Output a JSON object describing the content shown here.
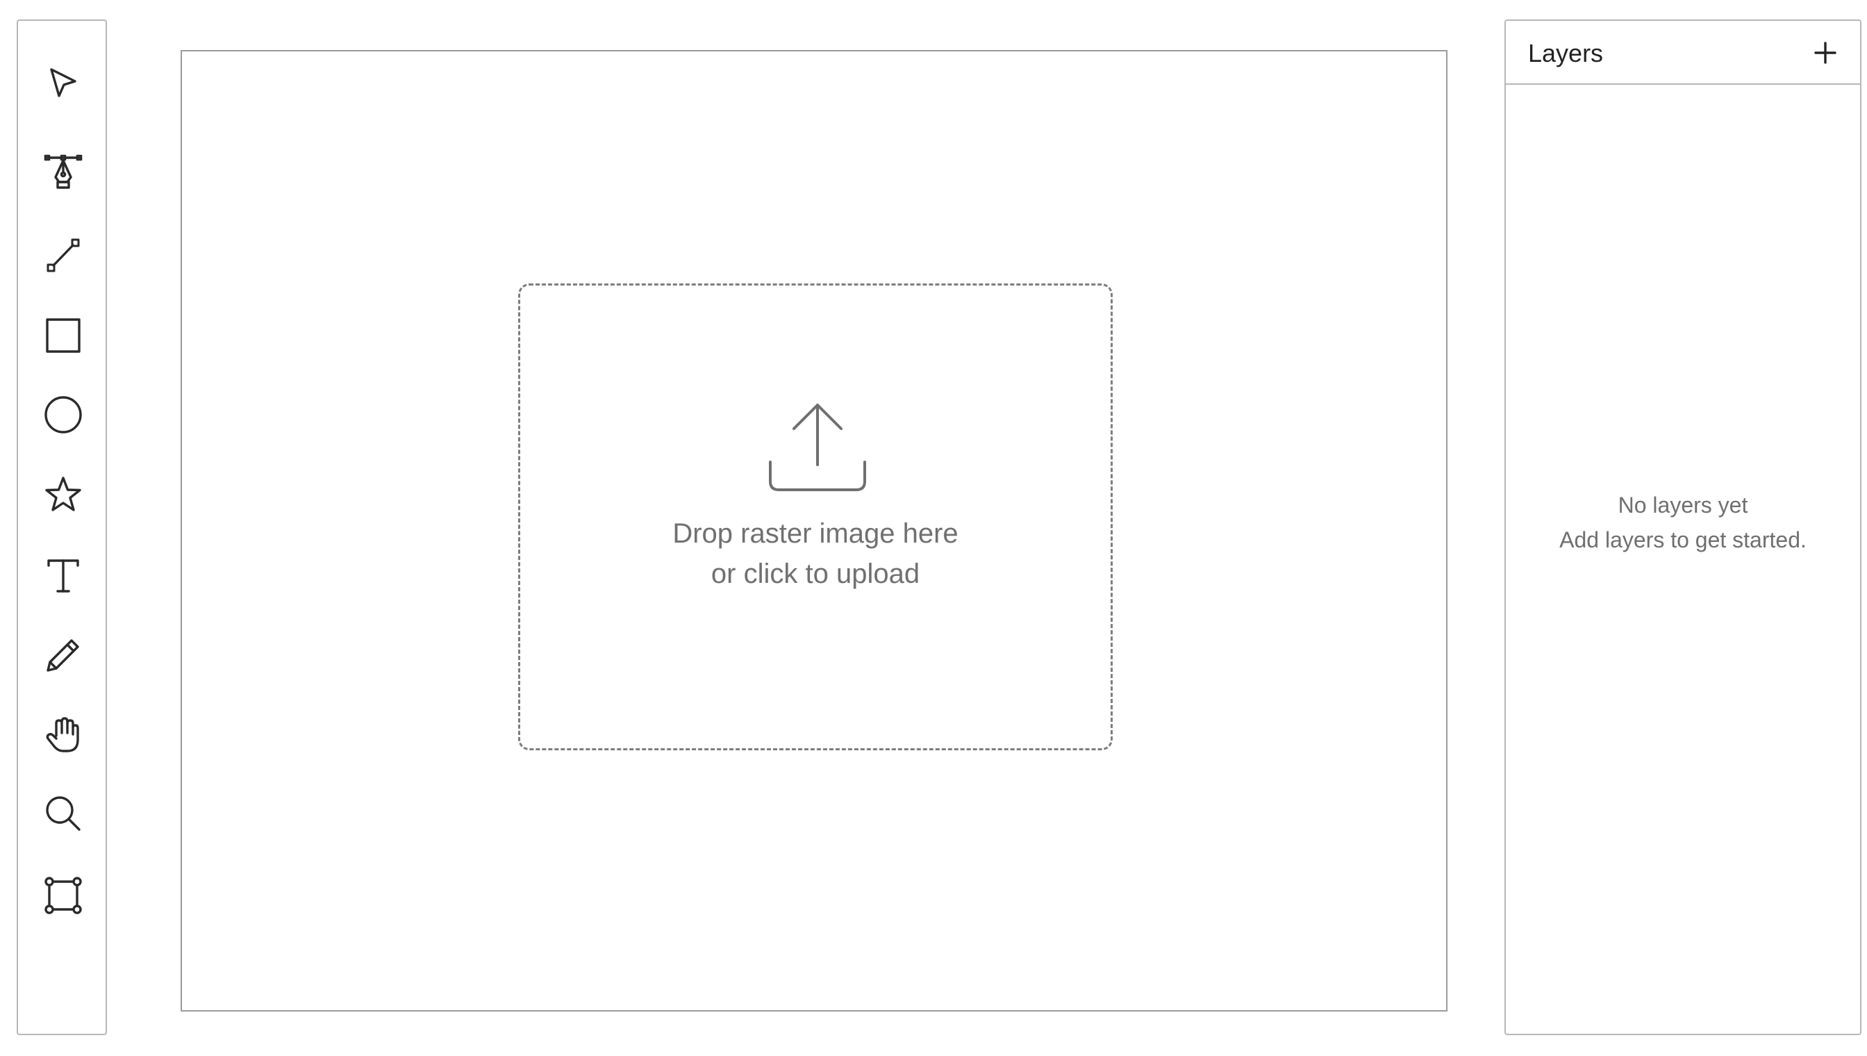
{
  "toolbar": {
    "tools": [
      {
        "name": "select",
        "icon": "cursor-arrow-icon"
      },
      {
        "name": "pen",
        "icon": "pen-tool-icon"
      },
      {
        "name": "line",
        "icon": "line-tool-icon"
      },
      {
        "name": "rectangle",
        "icon": "rectangle-icon"
      },
      {
        "name": "ellipse",
        "icon": "circle-icon"
      },
      {
        "name": "star",
        "icon": "star-icon"
      },
      {
        "name": "text",
        "icon": "text-icon"
      },
      {
        "name": "pencil",
        "icon": "pencil-icon"
      },
      {
        "name": "hand",
        "icon": "hand-icon"
      },
      {
        "name": "zoom",
        "icon": "magnifier-icon"
      },
      {
        "name": "transform",
        "icon": "bounding-box-icon"
      }
    ]
  },
  "canvas": {
    "dropzone": {
      "line1": "Drop raster image here",
      "line2": "or click to upload",
      "icon": "upload-icon"
    }
  },
  "layers": {
    "title": "Layers",
    "add_icon": "plus-icon",
    "empty_title": "No layers yet",
    "empty_subtitle": "Add layers to get started."
  },
  "colors": {
    "border": "#b7b7b7",
    "text_muted": "#707070",
    "icon": "#2a2a2a"
  }
}
